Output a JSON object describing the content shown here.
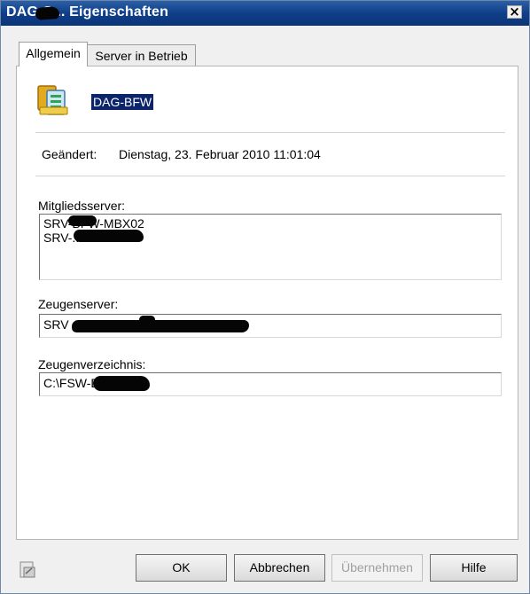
{
  "window": {
    "title": "DAG-S... Eigenschaften",
    "close_label": "×"
  },
  "tabs": [
    {
      "label": "Allgemein",
      "active": true
    },
    {
      "label": "Server in Betrieb",
      "active": false
    }
  ],
  "general": {
    "dag_name": "DAG-BFW",
    "changed_label": "Geändert:",
    "changed_value": "Dienstag, 23. Februar 2010 11:01:04",
    "member_servers_label": "Mitgliedsserver:",
    "member_servers": [
      "SRV-BFW-MBX02",
      "SRV-......01"
    ],
    "witness_server_label": "Zeugenserver:",
    "witness_server_value": "SRV",
    "witness_directory_label": "Zeugenverzeichnis:",
    "witness_directory_value": "C:\\FSW-D"
  },
  "buttons": {
    "ok": "OK",
    "cancel": "Abbrechen",
    "apply": "Übernehmen",
    "help": "Hilfe"
  }
}
